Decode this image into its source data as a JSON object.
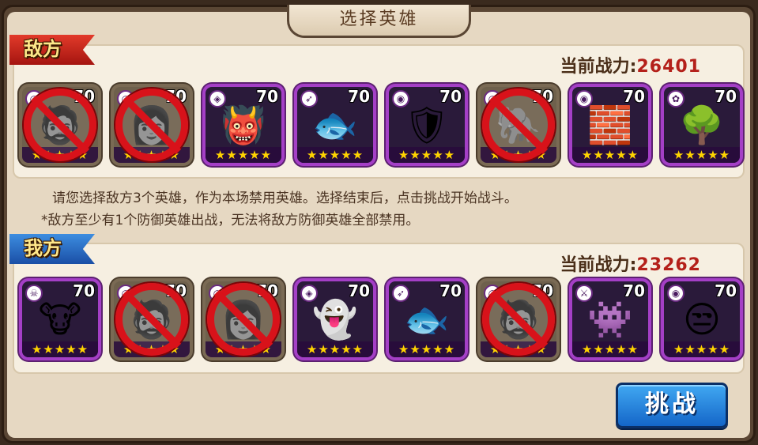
{
  "title": "选择英雄",
  "enemy": {
    "label": "敌方",
    "power_label": "当前战力:",
    "power_value": "26401",
    "heroes": [
      {
        "level": "70",
        "stars": "★★★★★",
        "banned": true,
        "portrait": "🧔",
        "class_icon": "◎"
      },
      {
        "level": "70",
        "stars": "★★★★★",
        "banned": true,
        "portrait": "👩",
        "class_icon": "◎"
      },
      {
        "level": "70",
        "stars": "★★★★★",
        "banned": false,
        "portrait": "👹",
        "class_icon": "◈"
      },
      {
        "level": "70",
        "stars": "★★★★★",
        "banned": false,
        "portrait": "🐟",
        "class_icon": "➶"
      },
      {
        "level": "70",
        "stars": "★★★★★",
        "banned": false,
        "portrait": "🛡",
        "class_icon": "◉"
      },
      {
        "level": "70",
        "stars": "★★★★★",
        "banned": true,
        "portrait": "🐘",
        "class_icon": "◎"
      },
      {
        "level": "70",
        "stars": "★★★★★",
        "banned": false,
        "portrait": "🧱",
        "class_icon": "◉"
      },
      {
        "level": "70",
        "stars": "★★★★★",
        "banned": false,
        "portrait": "🌳",
        "class_icon": "✿"
      }
    ]
  },
  "instructions": {
    "line1": "请您选择敌方3个英雄，作为本场禁用英雄。选择结束后，点击挑战开始战斗。",
    "line2": "*敌方至少有1个防御英雄出战，无法将敌方防御英雄全部禁用。"
  },
  "mine": {
    "label": "我方",
    "power_label": "当前战力:",
    "power_value": "23262",
    "heroes": [
      {
        "level": "70",
        "stars": "★★★★★",
        "banned": false,
        "portrait": "🐮",
        "class_icon": "☠"
      },
      {
        "level": "70",
        "stars": "★★★★★",
        "banned": true,
        "portrait": "🧔",
        "class_icon": "◎"
      },
      {
        "level": "70",
        "stars": "★★★★★",
        "banned": true,
        "portrait": "👩",
        "class_icon": "◎"
      },
      {
        "level": "70",
        "stars": "★★★★★",
        "banned": false,
        "portrait": "👻",
        "class_icon": "◈"
      },
      {
        "level": "70",
        "stars": "★★★★★",
        "banned": false,
        "portrait": "🐟",
        "class_icon": "➶"
      },
      {
        "level": "70",
        "stars": "★★★★★",
        "banned": true,
        "portrait": "🧔",
        "class_icon": "◎"
      },
      {
        "level": "70",
        "stars": "★★★★★",
        "banned": false,
        "portrait": "👾",
        "class_icon": "⚔"
      },
      {
        "level": "70",
        "stars": "★★★★★",
        "banned": false,
        "portrait": "😒",
        "class_icon": "◉"
      }
    ]
  },
  "challenge_button": "挑战",
  "colors": {
    "hero_border": "#a43fc6",
    "ban_red": "#d8121a",
    "enemy_ribbon": "#c8261c",
    "mine_ribbon": "#2a6cc4",
    "power_value": "#b4201a",
    "button_blue": "#1e7ad8"
  }
}
